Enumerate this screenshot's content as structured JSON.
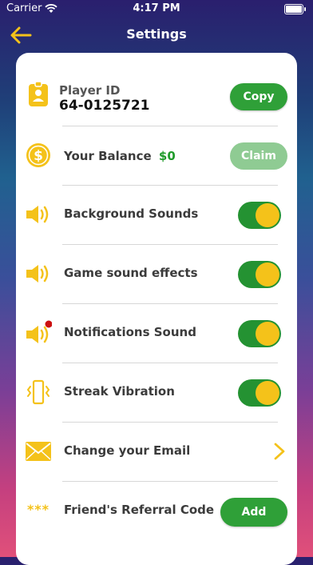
{
  "status_bar": {
    "carrier": "Carrier",
    "time": "4:17 PM"
  },
  "nav": {
    "title": "Settings"
  },
  "player": {
    "label": "Player ID",
    "id": "64-0125721",
    "copy_label": "Copy"
  },
  "balance": {
    "label": "Your Balance",
    "amount": "$0",
    "claim_label": "Claim"
  },
  "settings": {
    "background_sounds": "Background Sounds",
    "game_sound_effects": "Game sound effects",
    "notifications_sound": "Notifications Sound",
    "streak_vibration": "Streak Vibration",
    "change_email": "Change your Email",
    "referral_code": "Friend's Referral Code",
    "referral_stars": "***",
    "add_label": "Add"
  },
  "toggles": {
    "background_sounds": true,
    "game_sound_effects": true,
    "notifications_sound": true,
    "streak_vibration": true
  },
  "colors": {
    "accent_green": "#2fa038",
    "toggle_knob": "#f4c21a",
    "icon_yellow": "#f4c21a",
    "balance_green": "#1f9b2a"
  }
}
